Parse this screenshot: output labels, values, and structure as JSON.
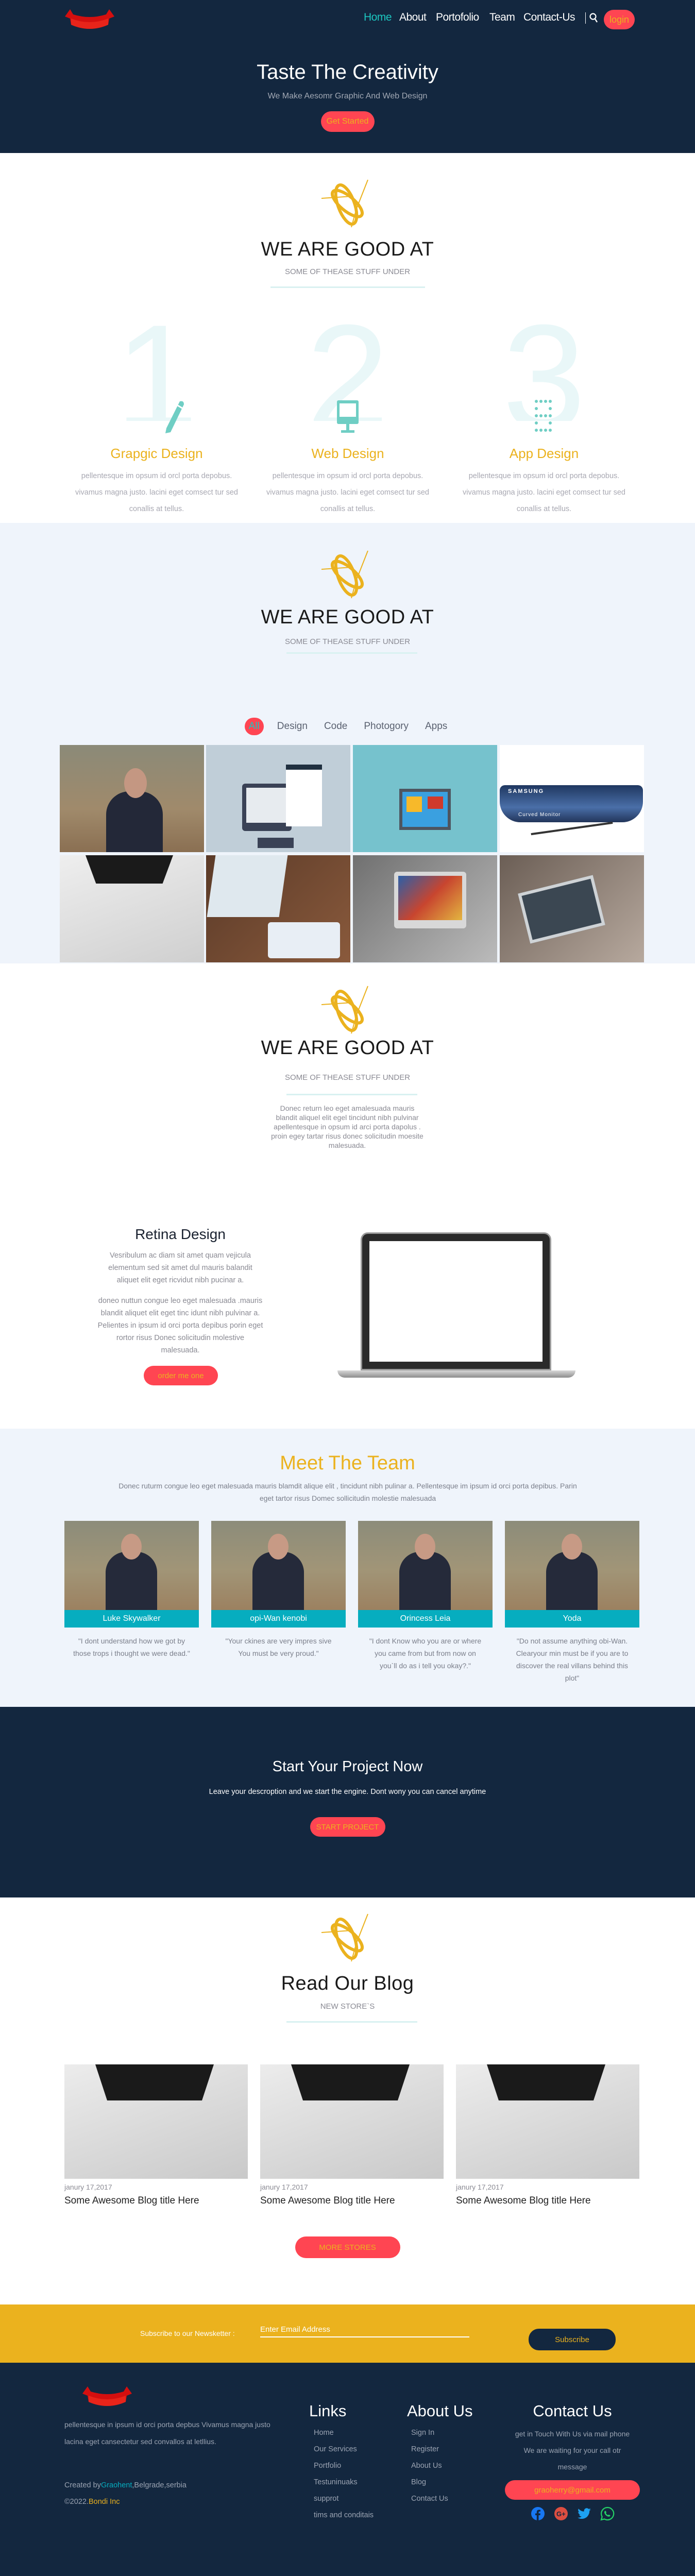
{
  "nav": {
    "items": [
      "Home",
      "About",
      "Portofolio",
      "Team",
      "Contact-Us"
    ],
    "login": "login"
  },
  "hero": {
    "title": "Taste The Creativity",
    "subtitle": "We Make Aesomr Graphic And Web Design",
    "cta": "Get Started"
  },
  "services": {
    "title": "WE ARE GOOD AT",
    "subtitle": "SOME OF THEASE STUFF UNDER",
    "items": [
      {
        "num": "1",
        "title": "Grapgic Design",
        "text": "pellentesque im opsum id orcl porta depobus. vivamus magna justo. lacini eget comsect tur sed conallis at tellus.",
        "icon": "pencil-icon"
      },
      {
        "num": "2",
        "title": "Web Design",
        "text": "pellentesque im opsum id orcl porta depobus. vivamus magna justo. lacini eget comsect tur sed conallis at tellus.",
        "icon": "monitor-icon"
      },
      {
        "num": "3",
        "title": "App Design",
        "text": "pellentesque im opsum id orcl porta depobus. vivamus magna justo. lacini eget comsect tur sed conallis at tellus.",
        "icon": "dots-grid-icon"
      }
    ]
  },
  "portfolio": {
    "title": "WE ARE GOOD AT",
    "subtitle": "SOME OF THEASE STUFF UNDER",
    "tabs": [
      "All",
      "Design",
      "Code",
      "Photogory",
      "Apps"
    ],
    "monitor_brand": "SAMSUNG",
    "monitor_caption": "Curved Monitor"
  },
  "about": {
    "title": "WE ARE GOOD AT",
    "subtitle": "SOME OF THEASE STUFF UNDER",
    "text": "Donec return leo eget amalesuada mauris blandit aliquel elit egel tincidunt nibh pulvinar apellentesque in opsum id arci porta dapolus . proin egey tartar risus donec solicitudin moesite malesuada.",
    "feature_title": "Retina Design",
    "p1": "Vesribulum ac diam sit amet quam vejicula elementum sed sit amet dul mauris balandit aliquet elit eget ricvidut nibh pucinar a.",
    "p2": "doneo nuttun congue leo eget malesuada .mauris blandit aliquet elit eget tinc idunt nibh pulvinar a. Pelientes in ipsum id orci porta depibus porin eget rortor risus Donec solicitudin molestive malesuada.",
    "cta": "order me one"
  },
  "team": {
    "title": "Meet The Team",
    "text": "Donec ruturm congue leo eget malesuada mauris blamdit alique elit , tincidunt nibh pulinar a. Pellentesque im ipsum id orci porta depibus. Parin eget tartor risus Domec sollicitudin molestie malesuada",
    "members": [
      {
        "name": "Luke Skywalker",
        "quote": "\"I dont understand how we got by those trops i thought we were dead.\""
      },
      {
        "name": "opi-Wan kenobi",
        "quote": "\"Your ckines are very impres sive You must be very proud.\""
      },
      {
        "name": "Orincess Leia",
        "quote": "\"I dont Know who you are or where you came from but from now on you`ll do as i tell you okay?.\""
      },
      {
        "name": "Yoda",
        "quote": "\"Do not assume anything obi-Wan. Clearyour min must be if you are to discover the real villans behind this plot\""
      }
    ]
  },
  "project": {
    "title": "Start Your Project Now",
    "text": "Leave your descroption and we start the engine. Dont wony you can cancel anytime",
    "cta": "START PROJECT"
  },
  "blog": {
    "title": "Read Our Blog",
    "subtitle": "NEW STORE`S",
    "posts": [
      {
        "date": "janury 17,2017",
        "title": "Some Awesome Blog title Here"
      },
      {
        "date": "janury 17,2017",
        "title": "Some Awesome Blog title Here"
      },
      {
        "date": "janury 17,2017",
        "title": "Some Awesome Blog title Here"
      }
    ],
    "cta": "MORE STORES"
  },
  "newsletter": {
    "label": "Subscribe to our Newsketter :",
    "placeholder": "Enter Email Address",
    "button": "Subscribe"
  },
  "footer": {
    "text": "pellentesque in ipsum id orci porta depbus Vivamus magna justo lacina eget cansectetur sed convallos at letllius.",
    "created_prefix": "Created by",
    "created_name": "Graohent",
    "created_suffix": ",Belgrade,serbia",
    "copy_prefix": "©2022.",
    "copy_company": "Bondi Inc",
    "links_title": "Links",
    "links": [
      "Home",
      "Our Services",
      "Portfolio",
      "Testuninuaks",
      "supprot",
      "tims and conditais"
    ],
    "about_title": "About Us",
    "about_links": [
      "Sign In",
      "Register",
      "About Us",
      "Blog",
      "Contact Us"
    ],
    "contact_title": "Contact Us",
    "contact_l1": "get in Touch With Us via mail phone",
    "contact_l2": "We are waiting for your call otr",
    "contact_l3": "message",
    "email": "graoherry@gmail.com",
    "social": [
      "facebook-icon",
      "google-plus-icon",
      "twitter-icon",
      "whatsapp-icon"
    ]
  },
  "colors": {
    "navy": "#13273f",
    "red": "#ff4552",
    "yellow": "#ebb21e",
    "teal": "#06adbf"
  }
}
